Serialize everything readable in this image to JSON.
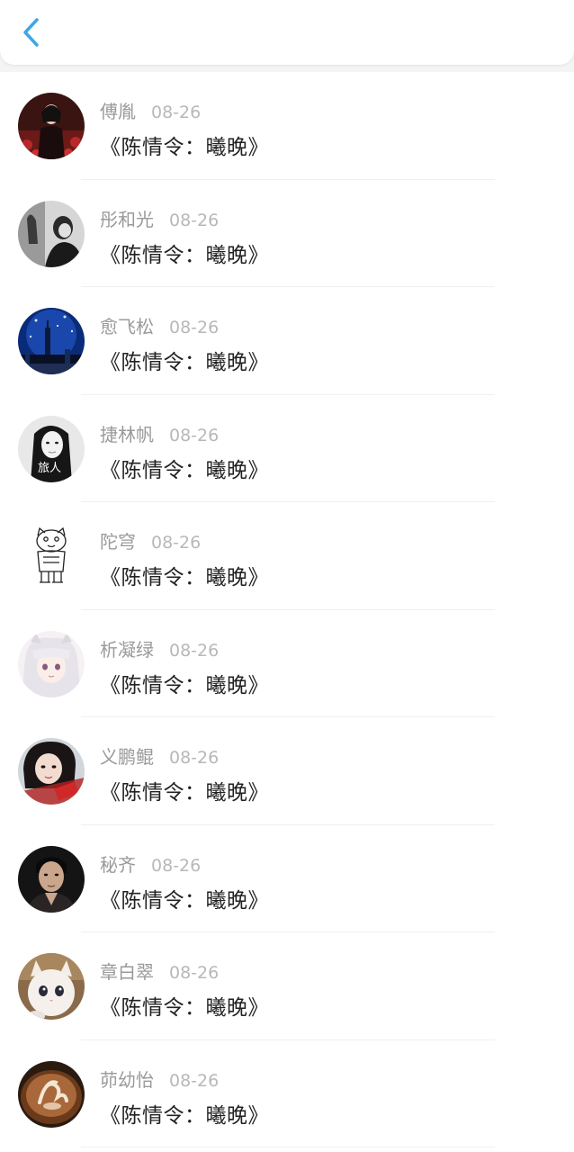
{
  "header": {
    "back_icon": "chevron-left-icon",
    "accent_color": "#3ea6e6"
  },
  "comments": [
    {
      "name": "傅胤",
      "date": "08-26",
      "text": "《陈情令：曦晚》",
      "avatar": "dark-portrait-red"
    },
    {
      "name": "彤和光",
      "date": "08-26",
      "text": "《陈情令：曦晚》",
      "avatar": "monochrome-portrait"
    },
    {
      "name": "愈飞松",
      "date": "08-26",
      "text": "《陈情令：曦晚》",
      "avatar": "blue-city-tower"
    },
    {
      "name": "捷林帆",
      "date": "08-26",
      "text": "《陈情令：曦晚》",
      "avatar": "monochrome-girl-travel"
    },
    {
      "name": "陀穹",
      "date": "08-26",
      "text": "《陈情令：曦晚》",
      "avatar": "line-art-cat"
    },
    {
      "name": "析凝绿",
      "date": "08-26",
      "text": "《陈情令：曦晚》",
      "avatar": "anime-white-hair"
    },
    {
      "name": "义鹏鲲",
      "date": "08-26",
      "text": "《陈情令：曦晚》",
      "avatar": "girl-red-stamp"
    },
    {
      "name": "秘齐",
      "date": "08-26",
      "text": "《陈情令：曦晚》",
      "avatar": "man-dark-portrait"
    },
    {
      "name": "章白翠",
      "date": "08-26",
      "text": "《陈情令：曦晚》",
      "avatar": "white-kitten"
    },
    {
      "name": "茆幼怡",
      "date": "08-26",
      "text": "《陈情令：曦晚》",
      "avatar": "latte-art"
    }
  ]
}
